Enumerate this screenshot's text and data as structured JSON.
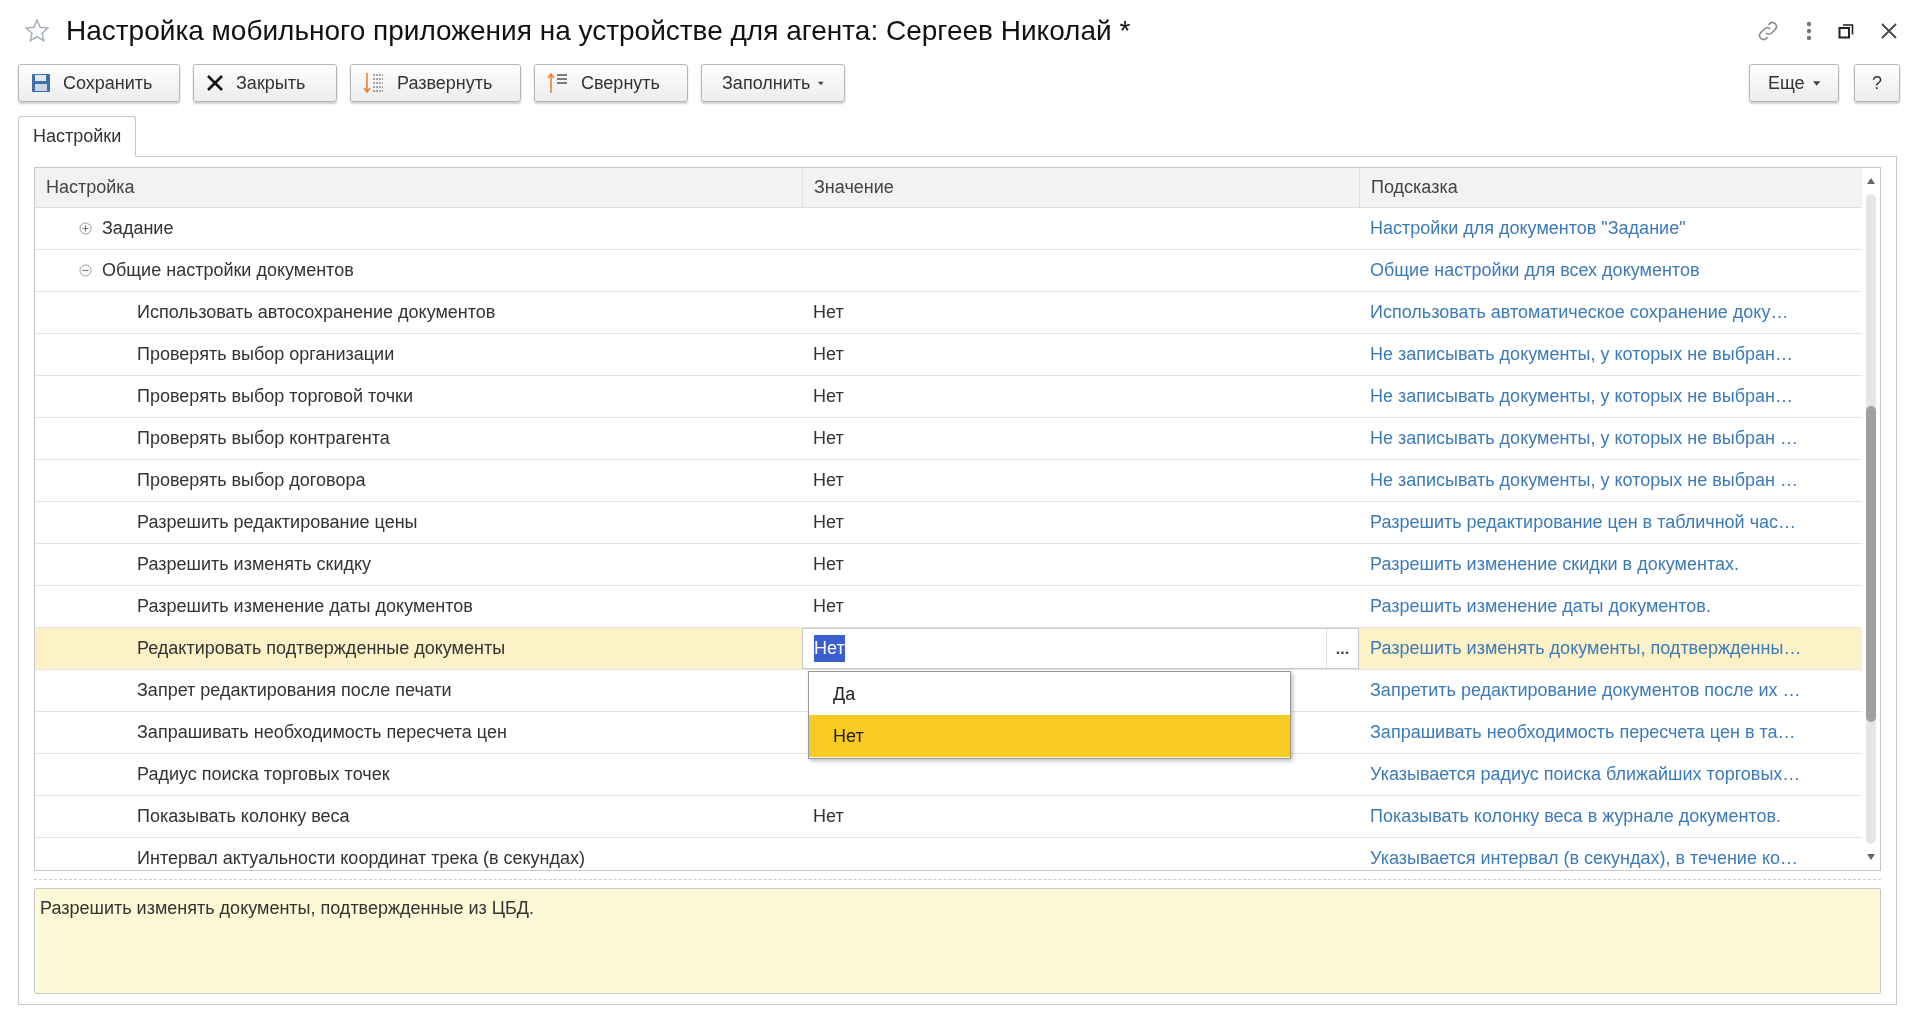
{
  "window": {
    "title": "Настройка мобильного приложения на устройстве для агента: Сергеев Николай *",
    "starred": false
  },
  "toolbar": [
    {
      "kind": "save",
      "label": "Сохранить"
    },
    {
      "kind": "close",
      "label": "Закрыть"
    },
    {
      "kind": "expand",
      "label": "Развернуть"
    },
    {
      "kind": "collapse",
      "label": "Свернуть"
    },
    {
      "kind": "menu",
      "label": "Заполнить"
    }
  ],
  "toolbar_right": [
    {
      "kind": "menu",
      "label": "Еще"
    },
    {
      "kind": "plain",
      "label": "?"
    }
  ],
  "tabs": [
    {
      "label": "Настройки",
      "selected": true
    }
  ],
  "table": {
    "columns": [
      "Настройка",
      "Значение",
      "Подсказка"
    ],
    "rows": [
      {
        "setting": "Задание",
        "hint": "Настройки для документов \"Задание\"",
        "expanded": false,
        "selected": false
      },
      {
        "setting": "Общие настройки документов",
        "hint": "Общие настройки для всех документов",
        "expanded": true,
        "selected": false,
        "children": [
          {
            "setting": "Использовать автосохранение документов",
            "value": "Нет",
            "hint": "Использовать автоматическое сохранение доку…",
            "selected": false
          },
          {
            "setting": "Проверять выбор организации",
            "value": "Нет",
            "hint": "Не записывать документы, у которых не выбран…",
            "selected": false
          },
          {
            "setting": "Проверять выбор торговой точки",
            "value": "Нет",
            "hint": "Не записывать документы, у которых не выбран…",
            "selected": false
          },
          {
            "setting": "Проверять выбор контрагента",
            "value": "Нет",
            "hint": "Не записывать документы, у которых не выбран …",
            "selected": false
          },
          {
            "setting": "Проверять выбор договора",
            "value": "Нет",
            "hint": "Не записывать документы, у которых не выбран …",
            "selected": false
          },
          {
            "setting": "Разрешить редактирование цены",
            "value": "Нет",
            "hint": "Разрешить редактирование цен в табличной час…",
            "selected": false
          },
          {
            "setting": "Разрешить изменять скидку",
            "value": "Нет",
            "hint": "Разрешить изменение скидки в документах.",
            "selected": false
          },
          {
            "setting": "Разрешить изменение даты документов",
            "value": "Нет",
            "hint": "Разрешить изменение даты документов.",
            "selected": false
          },
          {
            "setting": "Редактировать подтвержденные документы",
            "value": "Нет",
            "hint": "Разрешить изменять документы, подтвержденны…",
            "selected": true,
            "editing": true
          },
          {
            "setting": "Запрет редактирования после печати",
            "hint": "Запретить редактирование документов после их …",
            "selected": false
          },
          {
            "setting": "Запрашивать необходимость пересчета цен",
            "hint": "Запрашивать необходимость пересчета цен в та…",
            "selected": false
          },
          {
            "setting": "Радиус поиска торговых точек",
            "hint": "Указывается радиус поиска ближайших торговых…",
            "selected": false
          },
          {
            "setting": "Показывать колонку веса",
            "value": "Нет",
            "hint": "Показывать колонку веса в журнале документов.",
            "selected": false
          },
          {
            "setting": "Интервал актуальности координат трека (в секундах)",
            "hint": "Указывается интервал (в секундах), в течение ко…",
            "selected": false
          }
        ]
      }
    ]
  },
  "dropdown": {
    "options": [
      {
        "label": "Да",
        "selected": false
      },
      {
        "label": "Нет",
        "selected": true
      }
    ],
    "more_button": "..."
  },
  "description": "Разрешить изменять документы, подтвержденные из ЦБД."
}
